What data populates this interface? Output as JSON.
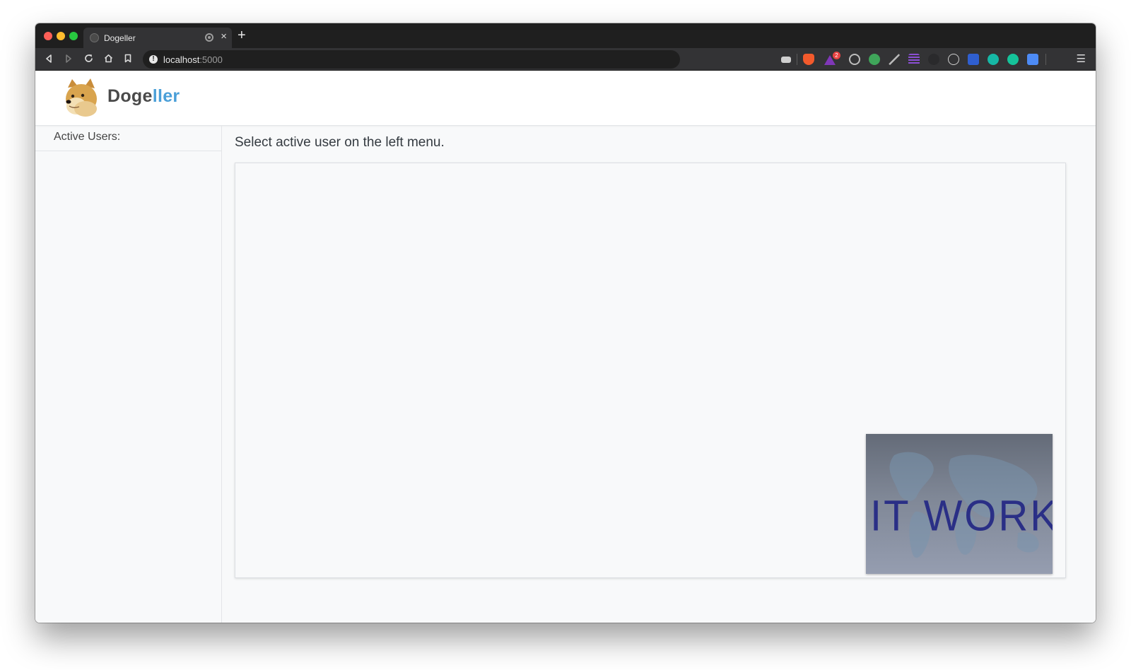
{
  "browser": {
    "tab_title": "Dogeller",
    "tab_close": "×",
    "new_tab": "+",
    "url_host": "localhost",
    "url_port": ":5000",
    "info_glyph": "!",
    "back_icon": "back-icon",
    "forward_icon": "forward-icon",
    "reload_icon": "reload-icon",
    "home_icon": "home-icon",
    "bookmark_icon": "bookmark-icon",
    "extensions_badge": "2",
    "menu_icon": "☰"
  },
  "app": {
    "brand_part1": "Doge",
    "brand_part2": "ller",
    "sidebar_title": "Active Users:",
    "main_title": "Select active user on the left menu.",
    "video_caption": "IT WORKS"
  },
  "colors": {
    "brand_dark": "#4a4a4a",
    "brand_accent": "#4a9fd8",
    "video_ink": "#2a2f86"
  }
}
